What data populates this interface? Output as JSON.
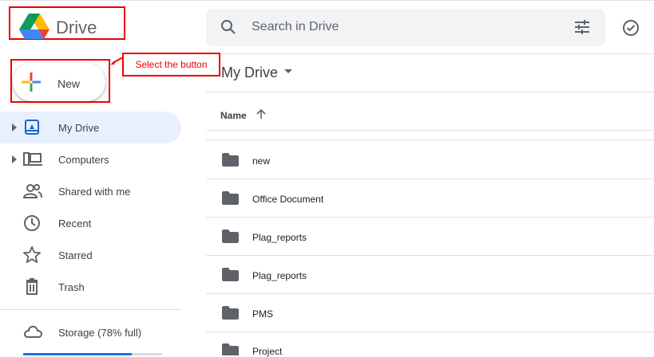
{
  "header": {
    "app_name": "Drive",
    "search_placeholder": "Search in Drive"
  },
  "new_button": {
    "label": "New"
  },
  "callout": {
    "text": "Select the button"
  },
  "sidebar": {
    "items": [
      {
        "label": "My Drive",
        "icon": "my-drive-icon"
      },
      {
        "label": "Computers",
        "icon": "computers-icon"
      },
      {
        "label": "Shared with me",
        "icon": "shared-icon"
      },
      {
        "label": "Recent",
        "icon": "clock-icon"
      },
      {
        "label": "Starred",
        "icon": "star-icon"
      },
      {
        "label": "Trash",
        "icon": "trash-icon"
      }
    ],
    "storage": {
      "label": "Storage (78% full)",
      "fraction": 0.78
    }
  },
  "main": {
    "breadcrumb": "My Drive",
    "column_name": "Name",
    "rows": [
      "new",
      "Office Document",
      "Plag_reports",
      "Plag_reports",
      "PMS",
      "Project"
    ]
  },
  "colors": {
    "accent": "#1a73e8",
    "active_bg": "#e8f0fe",
    "annotation": "#ee0000"
  }
}
